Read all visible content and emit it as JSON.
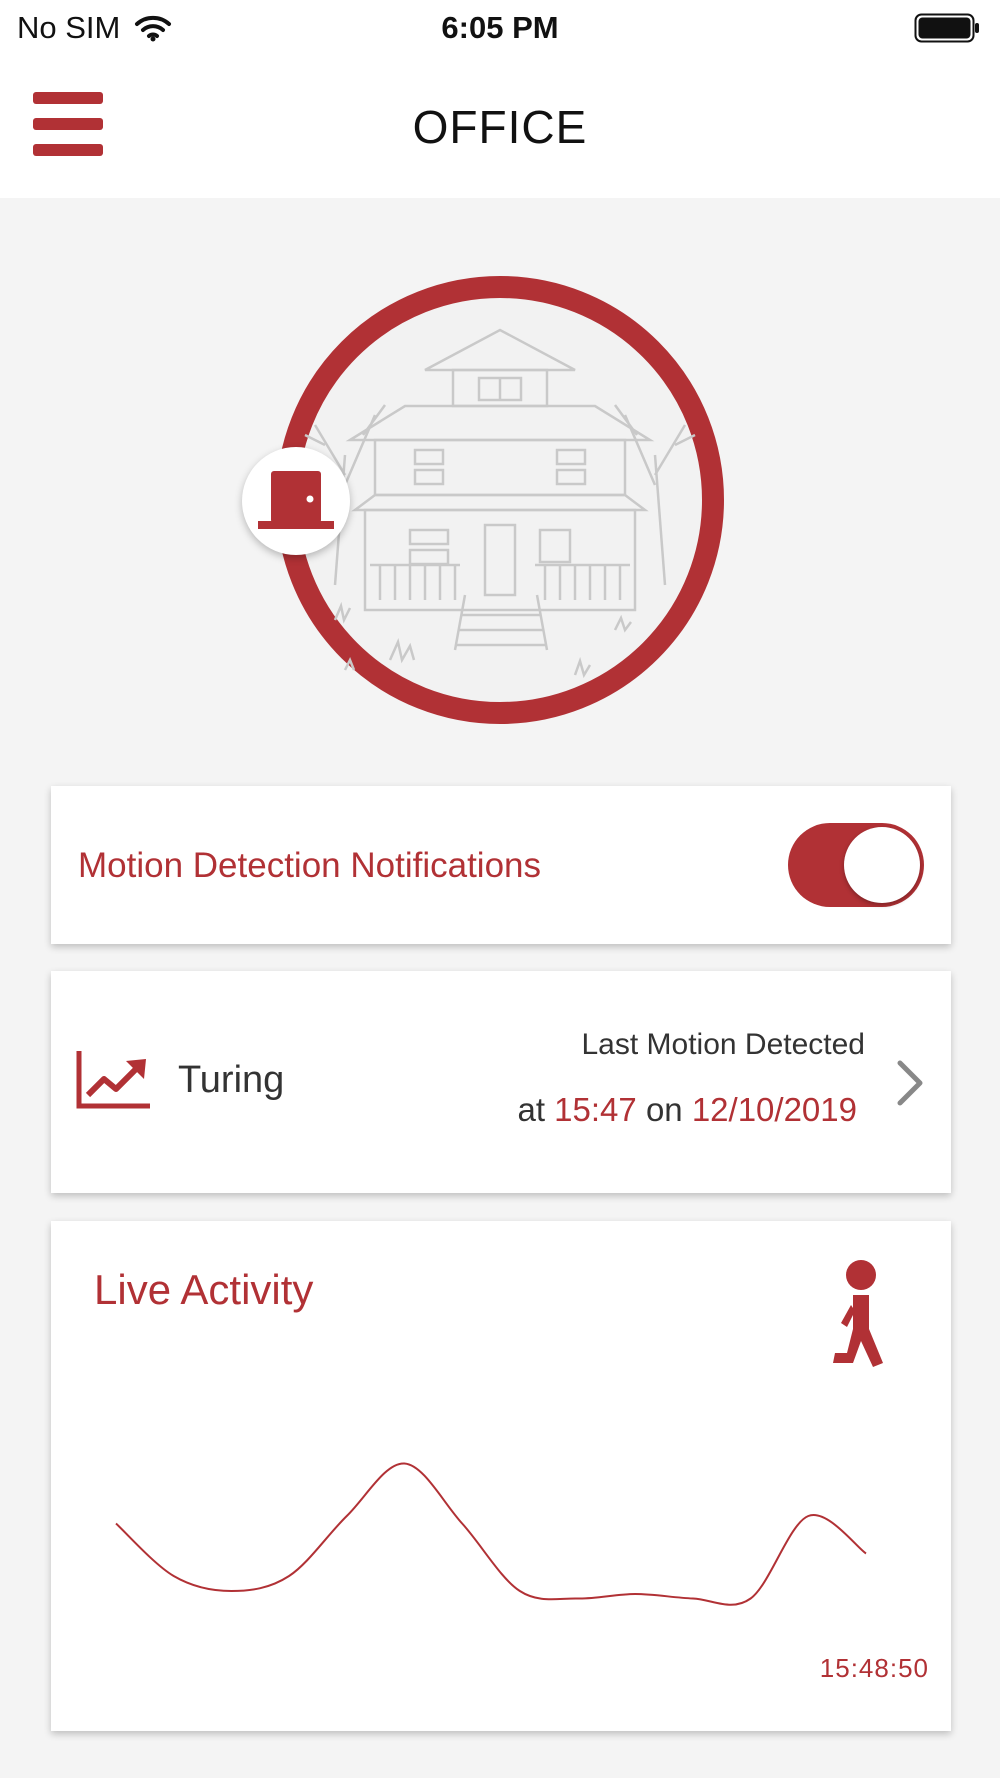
{
  "status_bar": {
    "carrier": "No SIM",
    "time": "6:05 PM",
    "wifi_icon": "wifi-icon",
    "battery_icon": "battery-full-icon"
  },
  "header": {
    "title": "OFFICE",
    "menu_icon": "hamburger-menu-icon"
  },
  "hero": {
    "image": "house-illustration",
    "badge_icon": "door-icon",
    "accent_color": "#b13135"
  },
  "motion_notifications": {
    "label": "Motion Detection Notifications",
    "enabled": true
  },
  "sensor": {
    "icon": "trend-chart-icon",
    "name": "Turing",
    "last_motion_title": "Last Motion Detected",
    "at_word": "at",
    "time": "15:47",
    "on_word": "on",
    "date": "12/10/2019",
    "chevron_icon": "chevron-right-icon"
  },
  "live_activity": {
    "title": "Live Activity",
    "icon": "walking-person-icon",
    "timestamp": "15:48:50"
  },
  "chart_data": {
    "type": "line",
    "title": "",
    "xlabel": "",
    "ylabel": "",
    "grid": false,
    "series": [
      {
        "values": [
          0.55,
          0.2,
          0.1,
          0.2,
          0.6,
          0.95,
          0.55,
          0.1,
          0.05,
          0.08,
          0.05,
          0.05,
          0.6,
          0.35
        ]
      }
    ],
    "color": "#b13135"
  }
}
